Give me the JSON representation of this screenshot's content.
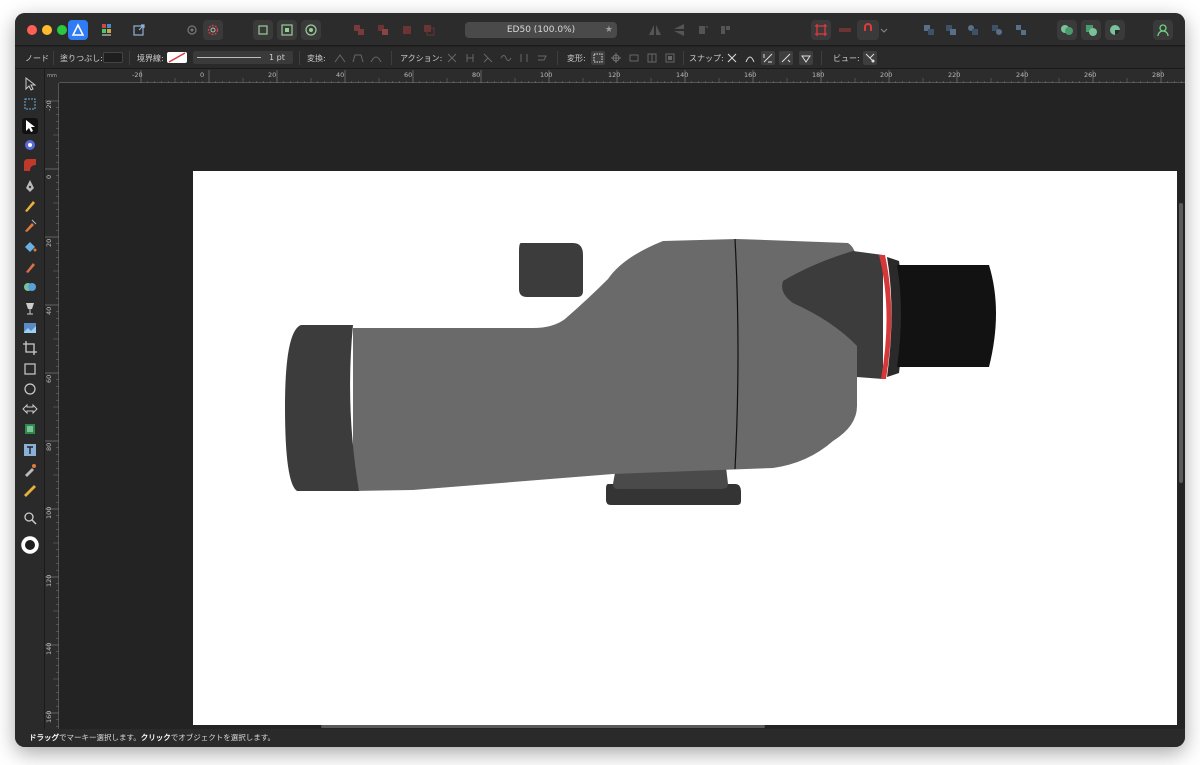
{
  "window": {
    "document_title": "ED50 (100.0%)",
    "title_star": "★"
  },
  "context_toolbar": {
    "node_label": "ノード",
    "fill_label": "塗りつぶし:",
    "stroke_label": "境界線:",
    "stroke_width": "1 pt",
    "convert_label": "変換:",
    "action_label": "アクション:",
    "transform_label": "変形:",
    "snap_label": "スナップ:",
    "view_label": "ビュー:"
  },
  "rulers": {
    "unit": "mm",
    "top_ticks": [
      "-20",
      "0",
      "20",
      "40",
      "60",
      "80",
      "100",
      "120",
      "140",
      "160",
      "180",
      "200",
      "220",
      "240",
      "260",
      "280"
    ],
    "left_ticks": [
      "-20",
      "0",
      "20",
      "40",
      "60",
      "80",
      "100",
      "120",
      "140",
      "160"
    ]
  },
  "tools": [
    {
      "name": "move-tool-icon"
    },
    {
      "name": "artboard-tool-icon"
    },
    {
      "name": "node-tool-icon",
      "active": true
    },
    {
      "name": "point-transform-tool-icon"
    },
    {
      "name": "corner-tool-icon"
    },
    {
      "name": "pen-tool-icon"
    },
    {
      "name": "pencil-tool-icon"
    },
    {
      "name": "vector-brush-tool-icon"
    },
    {
      "name": "fill-tool-icon"
    },
    {
      "name": "paint-brush-tool-icon"
    },
    {
      "name": "shape-builder-tool-icon"
    },
    {
      "name": "transparency-tool-icon"
    },
    {
      "name": "place-image-tool-icon"
    },
    {
      "name": "vector-crop-tool-icon"
    },
    {
      "name": "rectangle-tool-icon"
    },
    {
      "name": "ellipse-tool-icon"
    },
    {
      "name": "arrow-shape-tool-icon"
    },
    {
      "name": "contour-tool-icon"
    },
    {
      "name": "text-tool-icon"
    },
    {
      "name": "color-picker-tool-icon"
    },
    {
      "name": "measure-tool-icon"
    },
    {
      "name": "zoom-tool-icon"
    },
    {
      "name": "color-well-icon"
    }
  ],
  "status": {
    "drag_word": "ドラッグ",
    "drag_text": "でマーキー選択します。",
    "click_word": "クリック",
    "click_text": "でオブジェクトを選択します。"
  },
  "colors": {
    "app_accent": "#2f7cf6",
    "snapping_red": "#e0393e",
    "stroke_red": "#d6383a",
    "body_gray": "#6a6a6a",
    "dark_gray": "#3c3c3c",
    "eyepiece_black": "#121212"
  }
}
